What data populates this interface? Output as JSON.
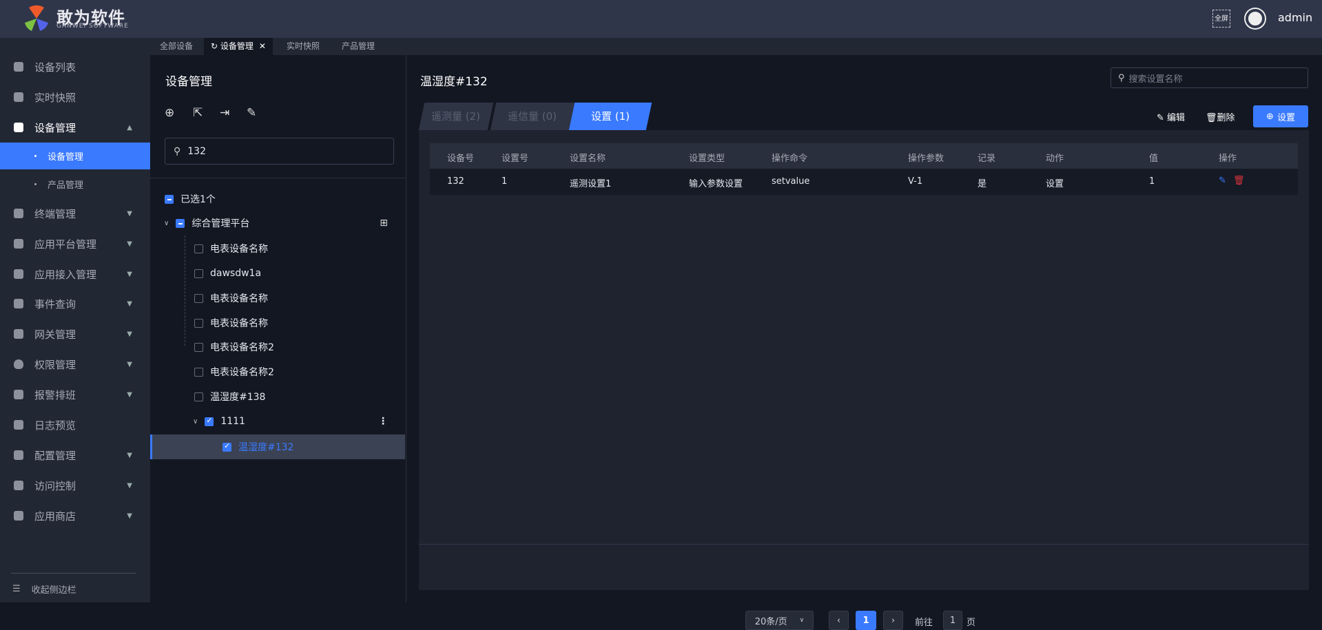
{
  "header": {
    "brand": "敢为软件",
    "brand_sub": "GANWEI SOFTWARE",
    "fullscreen": "全屏",
    "user": "admin"
  },
  "page_tabs": [
    {
      "label": "全部设备"
    },
    {
      "label": "设备管理"
    },
    {
      "label": "实时快照"
    },
    {
      "label": "产品管理"
    }
  ],
  "sidebar": {
    "items": [
      {
        "label": "设备列表"
      },
      {
        "label": "实时快照"
      },
      {
        "label": "设备管理"
      },
      {
        "label": "设备管理"
      },
      {
        "label": "产品管理"
      },
      {
        "label": "终端管理"
      },
      {
        "label": "应用平台管理"
      },
      {
        "label": "应用接入管理"
      },
      {
        "label": "事件查询"
      },
      {
        "label": "网关管理"
      },
      {
        "label": "权限管理"
      },
      {
        "label": "报警排班"
      },
      {
        "label": "日志预览"
      },
      {
        "label": "配置管理"
      },
      {
        "label": "访问控制"
      },
      {
        "label": "应用商店"
      }
    ],
    "collapse": "收起侧边栏"
  },
  "tree": {
    "title": "设备管理",
    "search_value": "132",
    "selected_count": "已选1个",
    "root": "综合管理平台",
    "nodes": [
      {
        "label": "电表设备名称"
      },
      {
        "label": "dawsdw1a"
      },
      {
        "label": "电表设备名称"
      },
      {
        "label": "电表设备名称"
      },
      {
        "label": "电表设备名称2"
      },
      {
        "label": "电表设备名称2"
      },
      {
        "label": "温湿度#138"
      }
    ],
    "group": "1111",
    "leaf": "温湿度#132"
  },
  "detail": {
    "title": "温湿度#132",
    "search_placeholder": "搜索设置名称",
    "tabs": [
      {
        "label": "遥测量 (2)"
      },
      {
        "label": "遥信量 (0)"
      },
      {
        "label": "设置 (1)"
      }
    ],
    "edit": "编辑",
    "delete": "删除",
    "add": "设置",
    "columns": [
      "设备号",
      "设置号",
      "设置名称",
      "设置类型",
      "操作命令",
      "操作参数",
      "记录",
      "动作",
      "值",
      "操作"
    ],
    "rows": [
      [
        "132",
        "1",
        "遥测设置1",
        "输入参数设置",
        "setvalue",
        "V-1",
        "是",
        "设置",
        "1"
      ]
    ],
    "pagination": {
      "page_size": "20条/页",
      "current": "1",
      "goto_label": "前往",
      "goto_value": "1",
      "page_suffix": "页"
    }
  },
  "colors": {
    "accent": "#3a7afe",
    "danger": "#e0343a"
  }
}
